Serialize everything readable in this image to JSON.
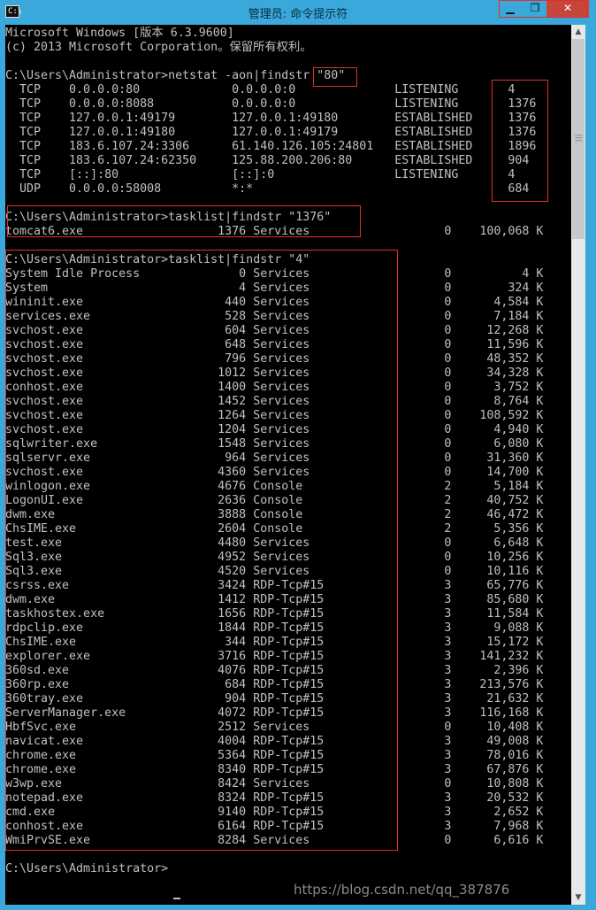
{
  "window": {
    "title": "管理员: 命令提示符",
    "icon_label": "C:\\",
    "minimize_label": "▁",
    "maximize_label": "❐",
    "close_label": "✕"
  },
  "console": {
    "lines": [
      "Microsoft Windows [版本 6.3.9600]",
      "(c) 2013 Microsoft Corporation。保留所有权利。",
      "",
      "C:\\Users\\Administrator>netstat -aon|findstr \"80\"",
      "  TCP    0.0.0.0:80             0.0.0.0:0              LISTENING       4",
      "  TCP    0.0.0.0:8088           0.0.0.0:0              LISTENING       1376",
      "  TCP    127.0.0.1:49179        127.0.0.1:49180        ESTABLISHED     1376",
      "  TCP    127.0.0.1:49180        127.0.0.1:49179        ESTABLISHED     1376",
      "  TCP    183.6.107.24:3306      61.140.126.105:24801   ESTABLISHED     1896",
      "  TCP    183.6.107.24:62350     125.88.200.206:80      ESTABLISHED     904",
      "  TCP    [::]:80                [::]:0                 LISTENING       4",
      "  UDP    0.0.0.0:58008          *:*                                    684",
      "",
      "C:\\Users\\Administrator>tasklist|findstr \"1376\"",
      "tomcat6.exe                   1376 Services                   0    100,068 K",
      "",
      "C:\\Users\\Administrator>tasklist|findstr \"4\"",
      "System Idle Process              0 Services                   0          4 K",
      "System                           4 Services                   0        324 K",
      "wininit.exe                    440 Services                   0      4,584 K",
      "services.exe                   528 Services                   0      7,184 K",
      "svchost.exe                    604 Services                   0     12,268 K",
      "svchost.exe                    648 Services                   0     11,596 K",
      "svchost.exe                    796 Services                   0     48,352 K",
      "svchost.exe                   1012 Services                   0     34,328 K",
      "conhost.exe                   1400 Services                   0      3,752 K",
      "svchost.exe                   1452 Services                   0      8,764 K",
      "svchost.exe                   1264 Services                   0    108,592 K",
      "svchost.exe                   1204 Services                   0      4,940 K",
      "sqlwriter.exe                 1548 Services                   0      6,080 K",
      "sqlservr.exe                   964 Services                   0     31,360 K",
      "svchost.exe                   4360 Services                   0     14,700 K",
      "winlogon.exe                  4676 Console                    2      5,184 K",
      "LogonUI.exe                   2636 Console                    2     40,752 K",
      "dwm.exe                       3888 Console                    2     46,472 K",
      "ChsIME.exe                    2604 Console                    2      5,356 K",
      "test.exe                      4480 Services                   0      6,648 K",
      "Sql3.exe                      4952 Services                   0     10,256 K",
      "Sql3.exe                      4520 Services                   0     10,116 K",
      "csrss.exe                     3424 RDP-Tcp#15                 3     65,776 K",
      "dwm.exe                       1412 RDP-Tcp#15                 3     85,680 K",
      "taskhostex.exe                1656 RDP-Tcp#15                 3     11,584 K",
      "rdpclip.exe                   1844 RDP-Tcp#15                 3      9,088 K",
      "ChsIME.exe                     344 RDP-Tcp#15                 3     15,172 K",
      "explorer.exe                  3716 RDP-Tcp#15                 3    141,232 K",
      "360sd.exe                     4076 RDP-Tcp#15                 3      2,396 K",
      "360rp.exe                      684 RDP-Tcp#15                 3    213,576 K",
      "360tray.exe                    904 RDP-Tcp#15                 3     21,632 K",
      "ServerManager.exe             4072 RDP-Tcp#15                 3    116,168 K",
      "HbfSvc.exe                    2512 Services                   0     10,408 K",
      "navicat.exe                   4004 RDP-Tcp#15                 3     49,008 K",
      "chrome.exe                    5364 RDP-Tcp#15                 3     78,016 K",
      "chrome.exe                    8340 RDP-Tcp#15                 3     67,876 K",
      "w3wp.exe                      8424 Services                   0     10,808 K",
      "notepad.exe                   8324 RDP-Tcp#15                 3     20,532 K",
      "cmd.exe                       9140 RDP-Tcp#15                 3      2,652 K",
      "conhost.exe                   6164 RDP-Tcp#15                 3      7,968 K",
      "WmiPrvSE.exe                  8284 Services                   0      6,616 K",
      "",
      "C:\\Users\\Administrator>"
    ]
  },
  "watermark": "https://blog.csdn.net/qq_387876",
  "colors": {
    "titlebar": "#3aa8da",
    "console_bg": "#000000",
    "console_text": "#c0c0c0",
    "highlight_box": "#e0302a",
    "close_button": "#c7463c"
  }
}
